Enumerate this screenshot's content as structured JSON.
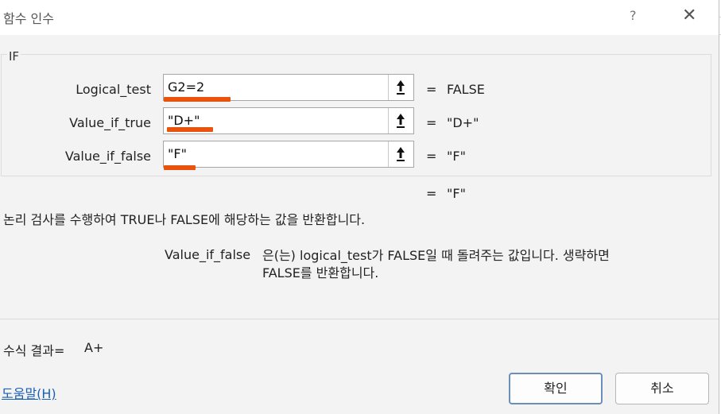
{
  "window": {
    "title": "함수 인수",
    "help_glyph": "?",
    "close_glyph": "✕"
  },
  "function_group": {
    "name": "IF",
    "args": [
      {
        "label": "Logical_test",
        "value": "G2=2",
        "equals": "=",
        "result": "FALSE"
      },
      {
        "label": "Value_if_true",
        "value": "\"D+\"",
        "equals": "=",
        "result": "\"D+\""
      },
      {
        "label": "Value_if_false",
        "value": "\"F\"",
        "equals": "=",
        "result": "\"F\""
      }
    ]
  },
  "overall_result": {
    "equals": "=",
    "value": "\"F\""
  },
  "description": "논리 검사를 수행하여 TRUE나 FALSE에 해당하는 값을 반환합니다.",
  "argument_help": {
    "name": "Value_if_false",
    "line1": "은(는) logical_test가 FALSE일 때 돌려주는 값입니다. 생략하면",
    "line2": "FALSE를 반환합니다."
  },
  "formula_result": {
    "label": "수식 결과=",
    "value": "A+"
  },
  "footer": {
    "help_link": "도움말(H)",
    "ok_label": "확인",
    "cancel_label": "취소"
  },
  "colors": {
    "annotation_redline": "#e8540d",
    "link": "#1a5fb4",
    "background": "#f3f3f3"
  },
  "icons": {
    "ref_button": "collapse-dialog-arrow-icon"
  }
}
